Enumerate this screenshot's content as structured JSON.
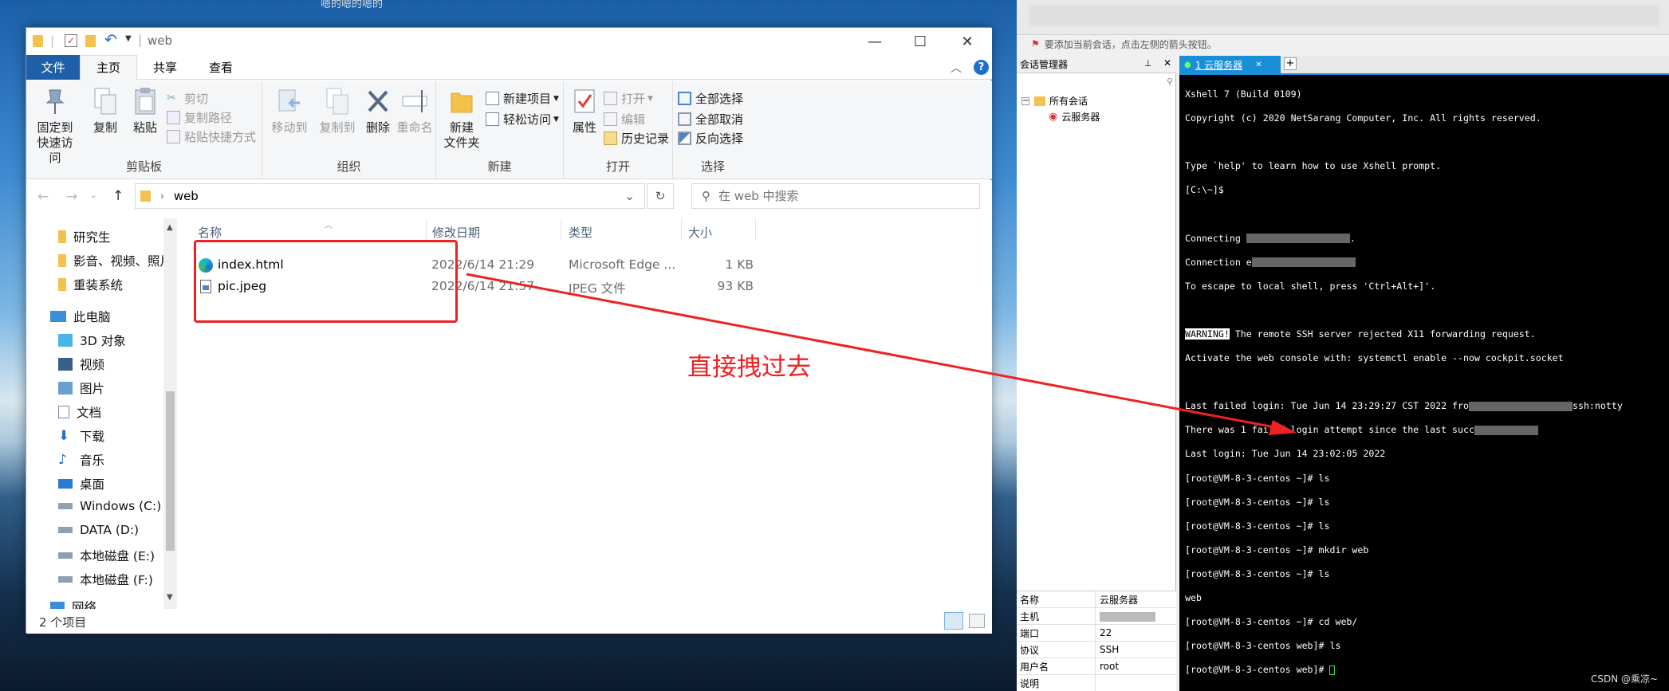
{
  "top_caption": "嗯的嗯的嗯的",
  "explorer": {
    "title": "web",
    "window_controls": {
      "minimize": "—",
      "maximize": "☐",
      "close": "✕"
    },
    "ribbon_tabs": [
      "文件",
      "主页",
      "共享",
      "查看"
    ],
    "clipboard": {
      "pin": "固定到\n快速访问",
      "copy": "复制",
      "paste": "粘贴",
      "cut": "剪切",
      "copy_path": "复制路径",
      "paste_shortcut": "粘贴快捷方式",
      "label": "剪贴板"
    },
    "organize": {
      "move_to": "移动到",
      "copy_to": "复制到",
      "delete": "删除",
      "rename": "重命名",
      "label": "组织"
    },
    "new": {
      "new_folder": "新建\n文件夹",
      "new_item": "新建项目",
      "easy_access": "轻松访问",
      "label": "新建"
    },
    "open": {
      "properties": "属性",
      "open": "打开",
      "edit": "编辑",
      "history": "历史记录",
      "label": "打开"
    },
    "select": {
      "select_all": "全部选择",
      "select_none": "全部取消",
      "invert": "反向选择",
      "label": "选择"
    },
    "address": {
      "path": "web",
      "search_placeholder": "在 web 中搜索"
    },
    "nav": {
      "quick": [
        "研究生",
        "影音、视频、照片",
        "重装系统"
      ],
      "this_pc": "此电脑",
      "pc_items": [
        "3D 对象",
        "视频",
        "图片",
        "文档",
        "下载",
        "音乐",
        "桌面",
        "Windows (C:)",
        "DATA (D:)",
        "本地磁盘 (E:)",
        "本地磁盘 (F:)"
      ],
      "network": "网络"
    },
    "columns": [
      "名称",
      "修改日期",
      "类型",
      "大小"
    ],
    "files": [
      {
        "name": "index.html",
        "date": "2022/6/14 21:29",
        "type": "Microsoft Edge ...",
        "size": "1 KB"
      },
      {
        "name": "pic.jpeg",
        "date": "2022/6/14 21:57",
        "type": "JPEG 文件",
        "size": "93 KB"
      }
    ],
    "status": "2 个项目"
  },
  "annotation": {
    "text": "直接拽过去",
    "color": "#ee2222"
  },
  "xshell": {
    "hint": "要添加当前会话，点击左侧的箭头按钮。",
    "session_panel_title": "会话管理器",
    "tree_root": "所有会话",
    "tree_child": "云服务器",
    "tab_label": "1 云服务器",
    "properties": [
      {
        "k": "名称",
        "v": "云服务器"
      },
      {
        "k": "主机",
        "v": ""
      },
      {
        "k": "端口",
        "v": "22"
      },
      {
        "k": "协议",
        "v": "SSH"
      },
      {
        "k": "用户名",
        "v": "root"
      },
      {
        "k": "说明",
        "v": ""
      }
    ],
    "terminal": {
      "l1": "Xshell 7 (Build 0109)",
      "l2": "Copyright (c) 2020 NetSarang Computer, Inc. All rights reserved.",
      "l3": "Type `help' to learn how to use Xshell prompt.",
      "l4": "[C:\\~]$",
      "l5": "Connecting ",
      "l6": "Connection e",
      "l7": "To escape to local shell, press 'Ctrl+Alt+]'.",
      "l8a": "WARNING!",
      "l8b": " The remote SSH server rejected X11 forwarding request.",
      "l9": "Activate the web console with: systemctl enable --now cockpit.socket",
      "l10a": "Last failed login: Tue Jun 14 23:29:27 CST 2022 fro",
      "l10b": "ssh:notty",
      "l11": "There was 1 failed login attempt since the last succ",
      "l12": "Last login: Tue Jun 14 23:02:05 2022",
      "l13": "[root@VM-8-3-centos ~]# ls",
      "l14": "[root@VM-8-3-centos ~]# ls",
      "l15": "[root@VM-8-3-centos ~]# ls",
      "l16": "[root@VM-8-3-centos ~]# mkdir web",
      "l17": "[root@VM-8-3-centos ~]# ls",
      "l18": "web",
      "l19": "[root@VM-8-3-centos ~]# cd web/",
      "l20": "[root@VM-8-3-centos web]# ls",
      "l21": "[root@VM-8-3-centos web]# "
    }
  },
  "watermark": "CSDN @乘凉~"
}
